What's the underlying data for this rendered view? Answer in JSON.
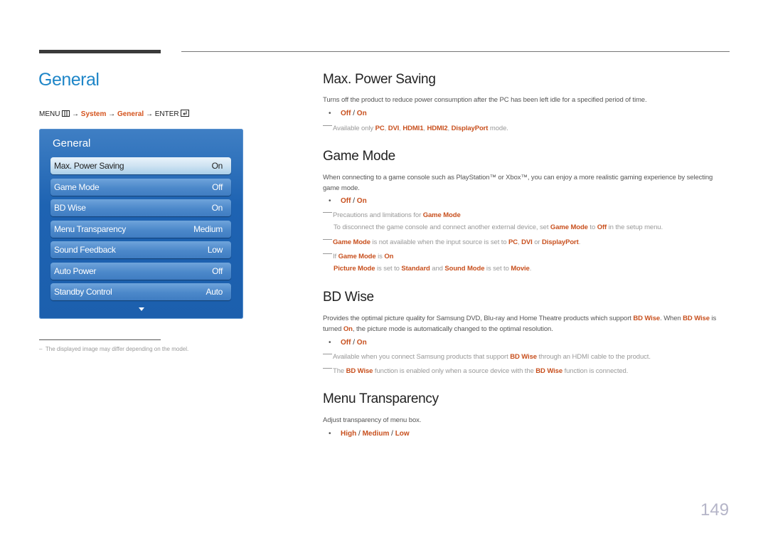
{
  "page_title": "General",
  "breadcrumb": {
    "menu": "MENU",
    "arrow": "→",
    "system": "System",
    "general": "General",
    "enter": "ENTER"
  },
  "osd": {
    "title": "General",
    "items": [
      {
        "label": "Max. Power Saving",
        "value": "On",
        "active": true
      },
      {
        "label": "Game Mode",
        "value": "Off"
      },
      {
        "label": "BD Wise",
        "value": "On"
      },
      {
        "label": "Menu Transparency",
        "value": "Medium"
      },
      {
        "label": "Sound Feedback",
        "value": "Low"
      },
      {
        "label": "Auto Power",
        "value": "Off"
      },
      {
        "label": "Standby Control",
        "value": "Auto"
      }
    ]
  },
  "footnote": "The displayed image may differ depending on the model.",
  "sections": {
    "max_power": {
      "title": "Max. Power Saving",
      "desc": "Turns off the product to reduce power consumption after the PC has been left idle for a specified period of time.",
      "opt1": "Off",
      "sep": " / ",
      "opt2": "On",
      "note_pre": "Available only ",
      "note_items": [
        "PC",
        "DVI",
        "HDMI1",
        "HDMI2",
        "DisplayPort"
      ],
      "note_post": " mode."
    },
    "game_mode": {
      "title": "Game Mode",
      "desc": "When connecting to a game console such as PlayStation™ or Xbox™, you can enjoy a more realistic gaming experience by selecting game mode.",
      "opt1": "Off",
      "sep": " / ",
      "opt2": "On",
      "note1_pre": "Precautions and limitations for ",
      "note1_hl": "Game Mode",
      "note1_sub_a": "To disconnect the game console and connect another external device, set ",
      "note1_sub_hl1": "Game Mode",
      "note1_sub_b": " to ",
      "note1_sub_hl2": "Off",
      "note1_sub_c": " in the setup menu.",
      "note2_hl": "Game Mode",
      "note2_a": " is not available when the input source is set to ",
      "note2_hl2": "PC",
      "note2_b": ", ",
      "note2_hl3": "DVI",
      "note2_c": " or ",
      "note2_hl4": "DisplayPort",
      "note2_d": ".",
      "note3_a": "If ",
      "note3_hl": "Game Mode",
      "note3_b": " is ",
      "note3_hl2": "On",
      "note3_sub_hl1": "Picture Mode",
      "note3_sub_a": " is set to ",
      "note3_sub_hl2": "Standard",
      "note3_sub_b": " and ",
      "note3_sub_hl3": "Sound Mode",
      "note3_sub_c": " is set to ",
      "note3_sub_hl4": "Movie",
      "note3_sub_d": "."
    },
    "bd_wise": {
      "title": "BD Wise",
      "desc_a": "Provides the optimal picture quality for Samsung DVD, Blu-ray and Home Theatre products which support ",
      "desc_hl1": "BD Wise",
      "desc_b": ". When ",
      "desc_hl2": "BD Wise",
      "desc_c": " is turned ",
      "desc_hl3": "On",
      "desc_d": ", the picture mode is automatically changed to the optimal resolution.",
      "opt1": "Off",
      "sep": " / ",
      "opt2": "On",
      "note1_a": "Available when you connect Samsung products that support ",
      "note1_hl": "BD Wise",
      "note1_b": " through an HDMI cable to the product.",
      "note2_a": "The ",
      "note2_hl": "BD Wise",
      "note2_b": " function is enabled only when a source device with the ",
      "note2_hl2": "BD Wise",
      "note2_c": " function is connected."
    },
    "menu_transparency": {
      "title": "Menu Transparency",
      "desc": "Adjust transparency of menu box.",
      "opt1": "High",
      "sep1": " / ",
      "opt2": "Medium",
      "sep2": " / ",
      "opt3": "Low"
    }
  },
  "page_number": "149",
  "colors": {
    "title_blue": "#1f86c8",
    "highlight": "#c8501e",
    "osd_blue": "#1e63b2"
  }
}
